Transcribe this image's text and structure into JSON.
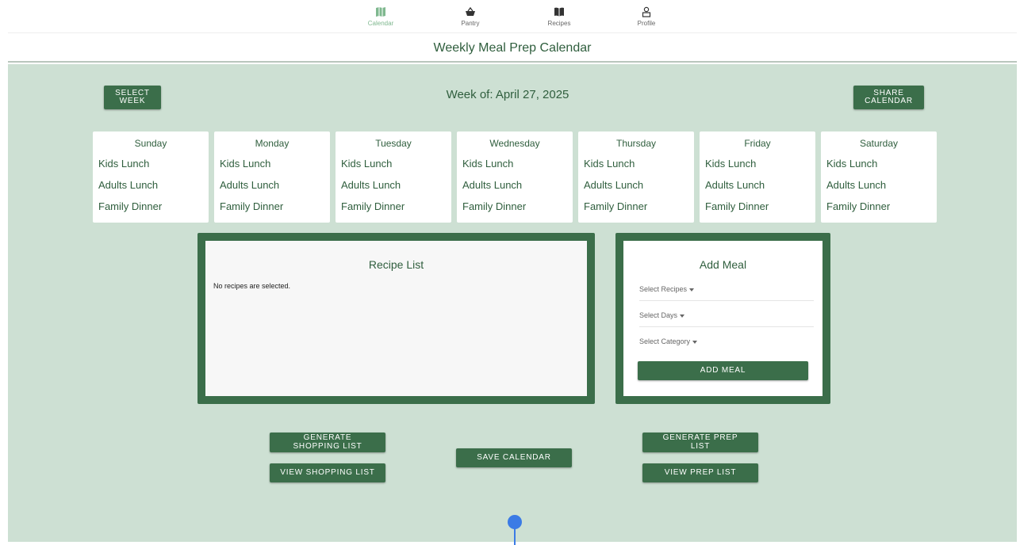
{
  "nav": {
    "items": [
      {
        "label": "Calendar",
        "icon": "map-icon",
        "active": true
      },
      {
        "label": "Pantry",
        "icon": "basket-icon"
      },
      {
        "label": "Recipes",
        "icon": "book-icon"
      },
      {
        "label": "Profile",
        "icon": "person-icon"
      }
    ]
  },
  "page": {
    "title": "Weekly Meal Prep Calendar",
    "week_label": "Week of: April 27, 2025"
  },
  "buttons": {
    "select_week": "SELECT\nWEEK",
    "share_calendar": "SHARE\nCALENDAR",
    "generate_shopping_list": "GENERATE\nSHOPPING LIST",
    "view_shopping_list": "VIEW SHOPPING LIST",
    "save_calendar": "SAVE CALENDAR",
    "generate_prep_list": "GENERATE PREP\nLIST",
    "view_prep_list": "VIEW PREP LIST",
    "add_meal": "ADD MEAL"
  },
  "days": [
    {
      "name": "Sunday",
      "meals": [
        "Kids Lunch",
        "Adults Lunch",
        "Family Dinner"
      ]
    },
    {
      "name": "Monday",
      "meals": [
        "Kids Lunch",
        "Adults Lunch",
        "Family Dinner"
      ]
    },
    {
      "name": "Tuesday",
      "meals": [
        "Kids Lunch",
        "Adults Lunch",
        "Family Dinner"
      ]
    },
    {
      "name": "Wednesday",
      "meals": [
        "Kids Lunch",
        "Adults Lunch",
        "Family Dinner"
      ]
    },
    {
      "name": "Thursday",
      "meals": [
        "Kids Lunch",
        "Adults Lunch",
        "Family Dinner"
      ]
    },
    {
      "name": "Friday",
      "meals": [
        "Kids Lunch",
        "Adults Lunch",
        "Family Dinner"
      ]
    },
    {
      "name": "Saturday",
      "meals": [
        "Kids Lunch",
        "Adults Lunch",
        "Family Dinner"
      ]
    }
  ],
  "recipe_list": {
    "title": "Recipe List",
    "empty_text": "No recipes are selected."
  },
  "add_meal": {
    "title": "Add Meal",
    "select_recipes": "Select Recipes",
    "select_days": "Select Days",
    "select_category": "Select Category"
  },
  "colors": {
    "accent": "#3b6e4a",
    "background": "#cde0d3",
    "text": "#2f5e3d",
    "marker": "#3b7be5"
  }
}
